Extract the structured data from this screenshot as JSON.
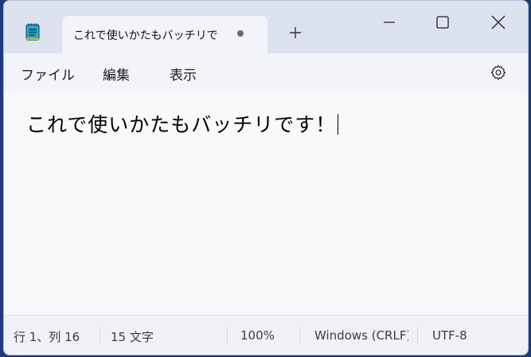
{
  "tab": {
    "title": "これで使いかたもバッチリで",
    "unsaved_indicator": "dot-icon",
    "new_tab_icon": "plus-icon"
  },
  "window_controls": [
    "minimize-icon",
    "maximize-icon",
    "close-icon"
  ],
  "menu": {
    "file": "ファイル",
    "edit": "編集",
    "view": "表示",
    "settings_icon": "gear-icon"
  },
  "editor": {
    "content": "これで使いかたもバッチリです！"
  },
  "status": {
    "position": "行 1、列 16",
    "char_count": "15 文字",
    "zoom": "100%",
    "line_ending": "Windows (CRLF)",
    "encoding": "UTF-8"
  },
  "colors": {
    "titlebar": "#dde2ef",
    "tab": "#f3f4f9",
    "editor_bg": "#f9f9fb",
    "desktop": "#1d3b7a"
  }
}
